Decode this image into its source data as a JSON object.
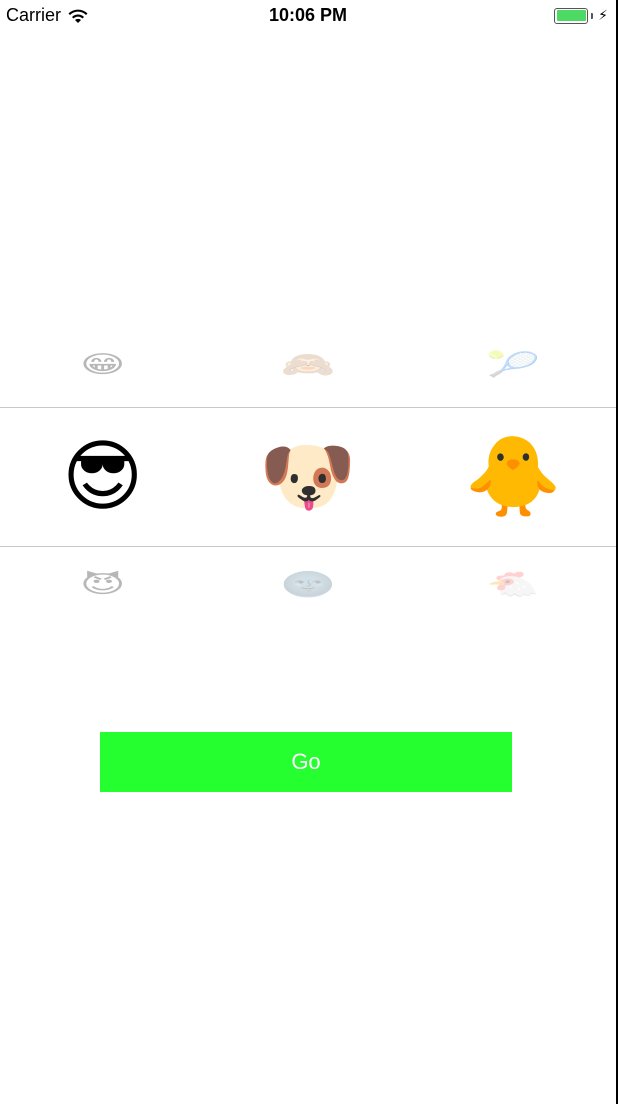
{
  "status_bar": {
    "carrier": "Carrier",
    "time": "10:06 PM",
    "battery_color": "#4cd964"
  },
  "picker": {
    "row_above": [
      "😁",
      "🙈",
      "🎾"
    ],
    "row_selected": [
      "😎",
      "🐶",
      "🐥"
    ],
    "row_below": [
      "😈",
      "🌚",
      "🐔"
    ]
  },
  "go_button": {
    "label": "Go",
    "color": "#25ff30"
  }
}
